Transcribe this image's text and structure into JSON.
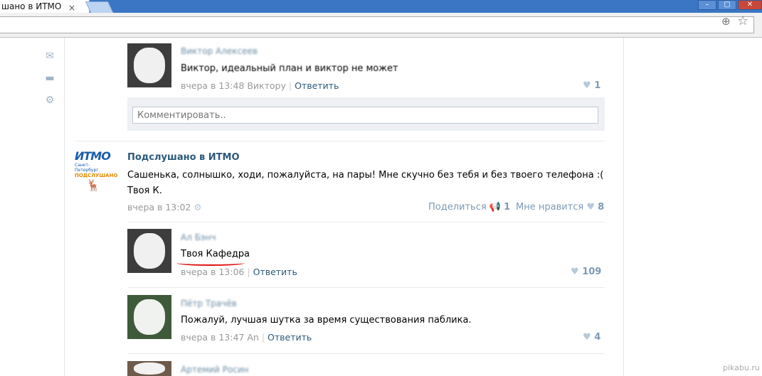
{
  "browser": {
    "tab_title": "шано в ИТМО",
    "tab_close": "×",
    "win_min": "–",
    "win_max": "▢",
    "win_close": "✕"
  },
  "comments_top": {
    "comment1": {
      "name": "Виктор Алексеев",
      "text": "Виктор, идеальный план и виктор не может",
      "time": "вчера в 13:48 Виктору",
      "reply": "Ответить",
      "likes": "1"
    },
    "comment_placeholder": "Комментировать.."
  },
  "post": {
    "group_name": "Подслушано в ИТМО",
    "text": "Сашенька, солнышко, ходи, пожалуйста, на пары! Мне скучно без тебя и без твоего телефона :( Твоя К.",
    "time": "вчера в 13:02",
    "share_label": "Поделиться",
    "share_count": "1",
    "like_label": "Мне нравится",
    "like_count": "8",
    "logo": {
      "title": "ИТМО",
      "sub": "Санкт-Петербург",
      "tag": "ПОДСЛУШАНО"
    }
  },
  "comments": [
    {
      "name": "Ал Бэнч",
      "text": "Твоя Кафедра",
      "time": "вчера в 13:06",
      "reply": "Ответить",
      "likes": "109"
    },
    {
      "name": "Пётр Трачёв",
      "text": "Пожалуй, лучшая шутка за время существования паблика.",
      "time": "вчера в 13:47 An",
      "reply": "Ответить",
      "likes": "4"
    },
    {
      "name": "Артемий Росин"
    }
  ],
  "watermark": "pikabu.ru"
}
